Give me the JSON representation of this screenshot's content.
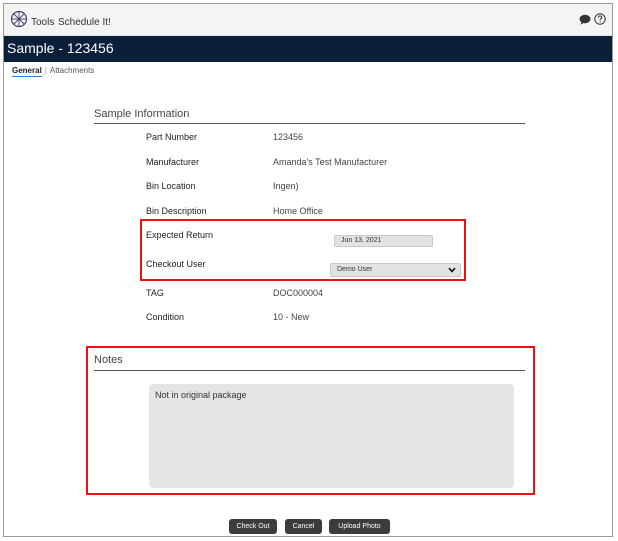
{
  "app": {
    "nav_tools": "Tools",
    "nav_schedule": "Schedule It!"
  },
  "header": {
    "title": "Sample - 123456"
  },
  "tabs": [
    {
      "label": "General",
      "active": true
    },
    {
      "label": "Attachments",
      "active": false
    }
  ],
  "tab_separator": "|",
  "sample_info": {
    "section_title": "Sample Information",
    "fields": [
      {
        "label": "Part Number",
        "value": "123456"
      },
      {
        "label": "Manufacturer",
        "value": "Amanda's Test Manufacturer"
      },
      {
        "label": "Bin Location",
        "value": "Ingen)"
      },
      {
        "label": "Bin Description",
        "value": "Home Office"
      },
      {
        "label": "Expected Return",
        "value": "Jun 13, 2021"
      },
      {
        "label": "Checkout User",
        "value": "Demo User"
      },
      {
        "label": "TAG",
        "value": "DOC000004"
      },
      {
        "label": "Condition",
        "value": "10 - New"
      }
    ]
  },
  "notes": {
    "section_title": "Notes",
    "text": "Not in original package"
  },
  "actions": {
    "checkout": "Check Out",
    "cancel": "Cancel",
    "upload": "Upload Photo"
  },
  "colors": {
    "title_bar": "#0b1f3a",
    "highlight": "#e11111",
    "button": "#3c3c3c",
    "field_bg": "#e2e2e2"
  },
  "icons": {
    "logo": "compass-logo-icon",
    "chat": "chat-bubble-icon",
    "help": "help-circle-icon",
    "dropdown": "chevron-down-icon"
  }
}
